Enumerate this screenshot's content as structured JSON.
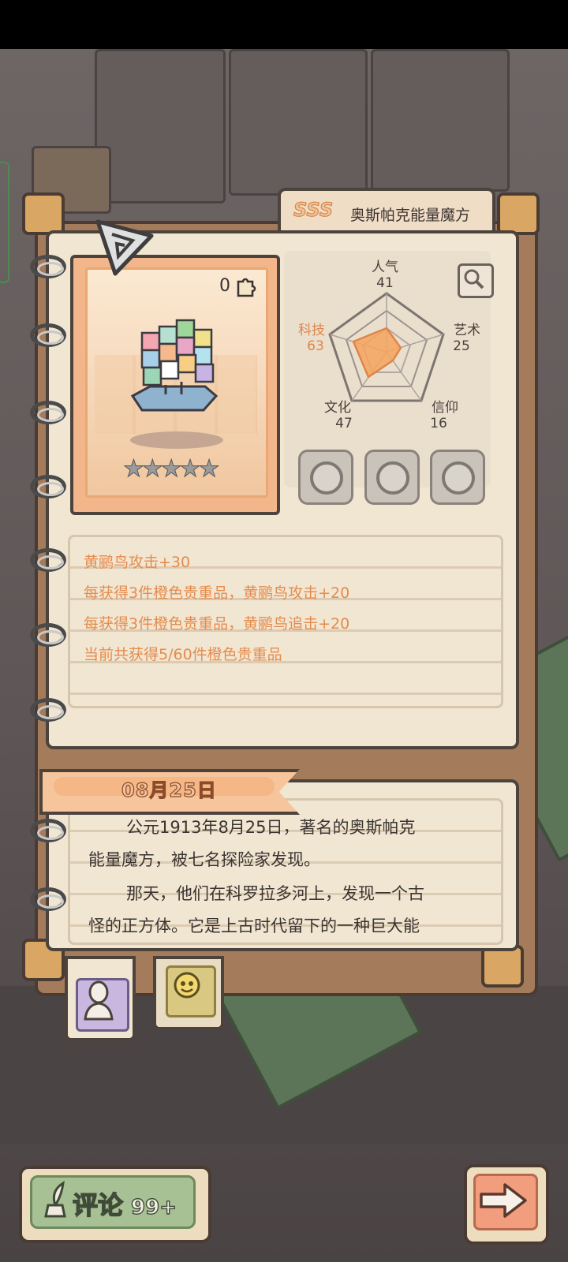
{
  "item": {
    "rank": "SSS",
    "name": "奥斯帕克能量魔方",
    "count": "0",
    "stars": "★★★★★"
  },
  "stats": {
    "popularity": {
      "label": "人气",
      "value": "41"
    },
    "art": {
      "label": "艺术",
      "value": "25"
    },
    "faith": {
      "label": "信仰",
      "value": "16"
    },
    "culture": {
      "label": "文化",
      "value": "47"
    },
    "tech": {
      "label": "科技",
      "value": "63"
    }
  },
  "effects": [
    "黄鹂鸟攻击+30",
    "每获得3件橙色贵重品，黄鹂鸟攻击+20",
    "每获得3件橙色贵重品，黄鹂鸟追击+20",
    "当前共获得5/60件橙色贵重品"
  ],
  "story": {
    "date": "08月25日",
    "lines": [
      "公元1913年8月25日，著名的奥斯帕克",
      "能量魔方，被七名探险家发现。",
      "那天，他们在科罗拉多河上，发现一个古",
      "怪的正方体。它是上古时代留下的一种巨大能"
    ]
  },
  "footer": {
    "comment_label": "评论",
    "comment_count": "99+"
  },
  "colors": {
    "accent_orange": "#e58b4c",
    "paper": "#f1e6d2",
    "outline": "#4d433d"
  }
}
